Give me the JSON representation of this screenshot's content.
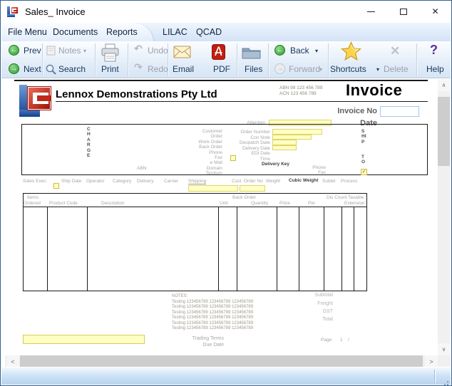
{
  "window": {
    "title": "Sales_ Invoice"
  },
  "icons": {
    "close": "✕",
    "minimize": "–",
    "dropdown": "▾",
    "prev_arrow": "←",
    "next_arrow": "→",
    "back_arrow": "←",
    "forward_arrow": "→",
    "undo": "↶",
    "redo": "↷",
    "delete": "✕",
    "help": "?",
    "check": "✓",
    "scroll_up": "∧",
    "scroll_down": "∨",
    "scroll_left": "<",
    "scroll_right": ">"
  },
  "menu": {
    "file": "File Menu",
    "documents": "Documents",
    "reports": "Reports",
    "lilac": "LILAC",
    "qcad": "QCAD"
  },
  "toolbar": {
    "prev": "Prev",
    "next": "Next",
    "notes": "Notes",
    "search": "Search",
    "print": "Print",
    "undo": "Undo",
    "redo": "Redo",
    "email": "Email",
    "pdf": "PDF",
    "files": "Files",
    "back": "Back",
    "forward": "Forward",
    "shortcuts": "Shortcuts",
    "delete": "Delete",
    "help": "Help"
  },
  "invoice": {
    "company": "Lennox Demonstrations Pty Ltd",
    "abn": "ABN 99 123 456 789",
    "acn": "ACN 123 456 789",
    "doc_title": "Invoice",
    "invoice_no_label": "Invoice No",
    "date_label": "Date",
    "attention_label": "Attention",
    "charge_vertical": "CHARGE",
    "ship_vertical": "SHIP",
    "to_vertical": "TO",
    "charge_labels": [
      "Customer",
      "Order",
      "Work Order",
      "Back Order",
      "Phone",
      "Fax",
      "e Mail",
      "Domain",
      "Territory"
    ],
    "abn_small_label": "ABN",
    "mid_labels": [
      "Order Number",
      "Con Note",
      "Despatch Date",
      "Delivery Date",
      "EDI Date",
      "Time"
    ],
    "delivery_key_label": "Delivery Key",
    "phone_label": "Phone",
    "fax_label": "Fax",
    "ship_row": {
      "sales_exec": "Sales Exec:",
      "ship_date": "Ship Date",
      "operator": "Operator",
      "category": "Category",
      "delivery": "Delivery",
      "carrier": "Carrier",
      "shipping": "Shipping",
      "cust_order_no": "Cust. Order No",
      "weight": "Weight",
      "cubic_weight": "Cubic Weight",
      "sublet": "Sublet",
      "process": "Process"
    },
    "table": {
      "items_1": "Items",
      "items_2": "Ordered",
      "product_code": "Product Code",
      "description": "Description",
      "back_order": "Back Order",
      "unit": "Unit",
      "quantity": "Quantity",
      "price": "Price",
      "per": "Per",
      "discount": "Dis Count",
      "taxable": "Taxable",
      "extension": "Extension"
    },
    "notes": {
      "title": "NOTES:",
      "lines": [
        "Testing 123456789 123456789 123456789",
        "Testing 123456789 123456789 123456789",
        "Testing 123456789 123456789 123456789",
        "Testing 123456789 123456789 123456789",
        "Testing 123456789 123456789 123456789",
        "Testing 123456789 123456789 123456789"
      ]
    },
    "totals": {
      "subtotal": "Subtotal",
      "freight": "Freight",
      "gst": "GST",
      "total": "Total"
    },
    "footer": {
      "trading_terms": "Trading Terms",
      "due_date": "Due Date",
      "page_label": "Page",
      "page_number": "1",
      "page_sep": "/"
    }
  },
  "colors": {
    "field_yellow": "#ffffc4",
    "logo_blue": "#123f8f",
    "logo_red": "#9c1005",
    "toolbar_text": "#16365c"
  }
}
